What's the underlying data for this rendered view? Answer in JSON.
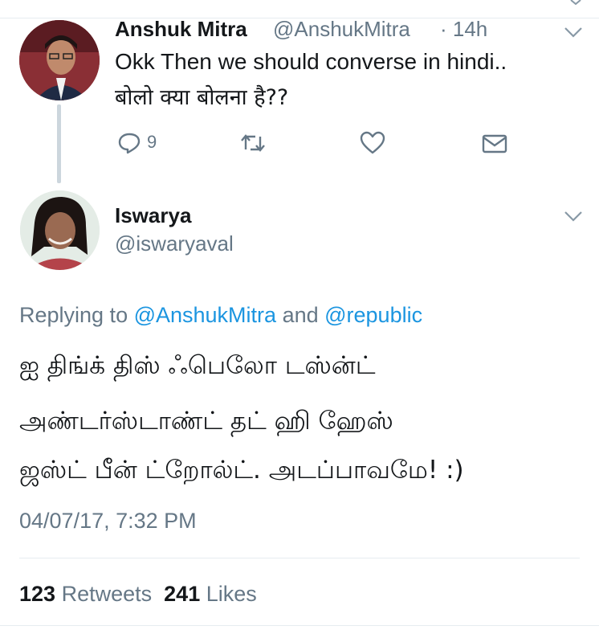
{
  "tweet1": {
    "name": "Anshuk Mitra",
    "handle": "@AnshukMitra",
    "time": "· 14h",
    "text_line1": "Okk Then we should converse in hindi..",
    "text_line2": "बोलो क्या बोलना है??",
    "reply_count": "9",
    "icons": {
      "reply": "reply-icon",
      "retweet": "retweet-icon",
      "like": "heart-icon",
      "dm": "envelope-icon",
      "menu": "chevron-down-icon"
    }
  },
  "tweet2": {
    "name": "Iswarya",
    "handle": "@iswaryaval",
    "replying_prefix": "Replying to ",
    "replying_mention1": "@AnshukMitra",
    "replying_and": " and ",
    "replying_mention2": "@republic",
    "body_line1": "ஐ திங்க் திஸ் ஃபெலோ டஸ்ன்ட்",
    "body_line2": "அண்டர்ஸ்டாண்ட் தட் ஹி ஹேஸ்",
    "body_line3": "ஜஸ்ட் பீன் ட்றோல்ட். அடப்பாவமே! :)",
    "timestamp": "04/07/17, 7:32 PM",
    "retweets_count": "123",
    "retweets_label": "Retweets",
    "likes_count": "241",
    "likes_label": "Likes"
  },
  "colors": {
    "text": "#14171a",
    "secondary": "#657786",
    "link": "#1b95e0",
    "divider": "#e6ecf0",
    "thread_line": "#ccd6dd"
  }
}
